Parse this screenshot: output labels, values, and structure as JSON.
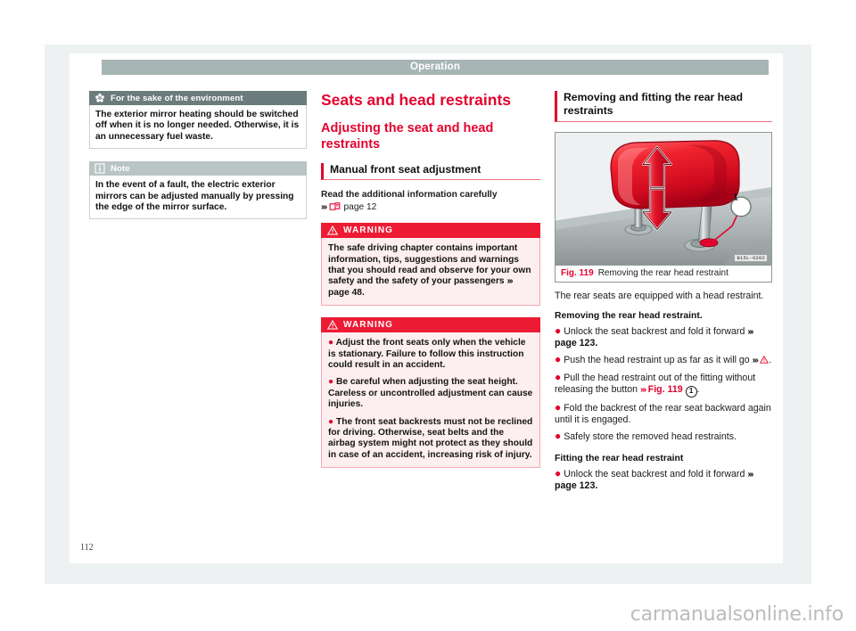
{
  "header": {
    "title": "Operation"
  },
  "folio": {
    "page_number": "112"
  },
  "watermark": {
    "text": "carmanualsonline.info"
  },
  "left_column": {
    "environment_box": {
      "icon": "flower-environment-icon",
      "heading": "For the sake of the environment",
      "body": "The exterior mirror heating should be switched off when it is no longer needed. Otherwise, it is an unnecessary fuel waste."
    },
    "note_box": {
      "icon": "info-icon",
      "heading": "Note",
      "body": "In the event of a fault, the electric exterior mirrors can be adjusted manually by pressing the edge of the mirror surface."
    }
  },
  "middle_column": {
    "chapter_title": "Seats and head restraints",
    "section_title": "Adjusting the seat and head restraints",
    "subsection_title": "Manual front seat adjustment",
    "intro_line1": "Read the additional information carefully",
    "intro_ref": "page 12",
    "intro_chevron": "›››",
    "warning_label": "WARNING",
    "warning_1": {
      "text_before_ref": "The safe driving chapter contains important information, tips, suggestions and warnings that you should read and observe for your own safety and the safety of your passengers",
      "ref": "page 48",
      "chevron": "›››",
      "trailing": "."
    },
    "warning_2": {
      "bullets": [
        "Adjust the front seats only when the vehicle is stationary. Failure to follow this instruction could result in an accident.",
        "Be careful when adjusting the seat height. Careless or uncontrolled adjustment can cause injuries.",
        "The front seat backrests must not be reclined for driving. Otherwise, seat belts and the airbag system might not protect as they should in case of an accident, increasing risk of injury."
      ]
    }
  },
  "right_column": {
    "subsection_title": "Removing and fitting the rear head restraints",
    "figure": {
      "image_code": "B15L-0202",
      "callout_number": "1",
      "caption_number": "Fig. 119",
      "caption_text": "Removing the rear head restraint",
      "alt": "rear head restraint illustration with up-down arrows and release button"
    },
    "intro_paragraph": "The rear seats are equipped with a head restraint.",
    "removing_heading": "Removing the rear head restraint.",
    "removing_bullets": [
      {
        "text": "Unlock the seat backrest and fold it forward",
        "ref": "page 123.",
        "chevron": "›››",
        "ref_style": "bold"
      },
      {
        "text": "Push the head restraint up as far as it will go",
        "ref": "⚠",
        "chevron": "›››",
        "ref_style": "warning-triangle"
      },
      {
        "text": "Pull the head restraint out of the fitting without releasing the button",
        "ref": "Fig. 119",
        "chevron": "›››",
        "ref_style": "red",
        "circled": "1"
      },
      {
        "text": "Fold the backrest of the rear seat backward again until it is engaged.",
        "ref": "",
        "chevron": "",
        "ref_style": "none"
      },
      {
        "text": "Safely store the removed head restraints.",
        "ref": "",
        "chevron": "",
        "ref_style": "none"
      }
    ],
    "fitting_heading": "Fitting the rear head restraint",
    "fitting_bullets": [
      {
        "text": "Unlock the seat backrest and fold it forward",
        "ref": "page 123.",
        "chevron": "›››",
        "ref_style": "bold"
      }
    ]
  },
  "colors": {
    "accent_red": "#e3032e",
    "warning_red": "#ed1b34",
    "header_gray": "#a8b5b5",
    "env_head_gray": "#6c7b7b",
    "note_head_gray": "#b9c4c4",
    "panel_bg": "#eef1f2"
  }
}
